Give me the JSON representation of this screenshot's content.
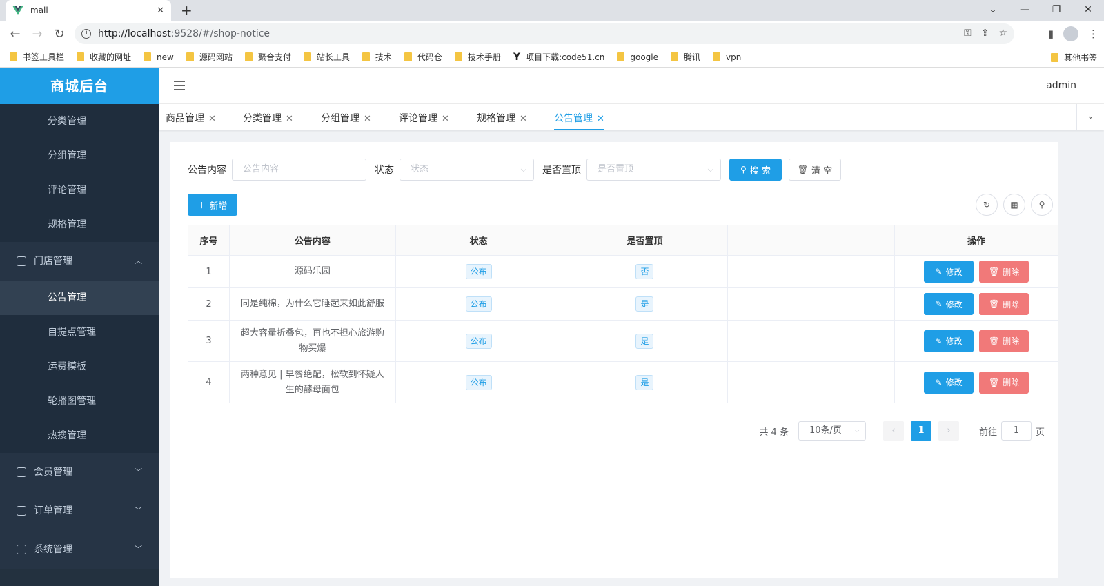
{
  "browser": {
    "tab_title": "mall",
    "url_host": "http://localhost",
    "url_rest": ":9528/#/shop-notice",
    "new_tab": "+",
    "tab_close": "✕"
  },
  "bookmarks": [
    {
      "label": "书签工具栏"
    },
    {
      "label": "收藏的网址"
    },
    {
      "label": "new"
    },
    {
      "label": "源码网站"
    },
    {
      "label": "聚合支付"
    },
    {
      "label": "站长工具"
    },
    {
      "label": "技术"
    },
    {
      "label": "代码仓"
    },
    {
      "label": "技术手册"
    },
    {
      "label": "项目下载:code51.cn"
    },
    {
      "label": "google"
    },
    {
      "label": "腾讯"
    },
    {
      "label": "vpn"
    }
  ],
  "bookmarks_other": "其他书签",
  "app": {
    "brand": "商城后台",
    "user": "admin"
  },
  "sidebar": {
    "items": [
      {
        "label": "分类管理",
        "type": "sub"
      },
      {
        "label": "分组管理",
        "type": "sub"
      },
      {
        "label": "评论管理",
        "type": "sub"
      },
      {
        "label": "规格管理",
        "type": "sub"
      },
      {
        "label": "门店管理",
        "type": "group",
        "icon": "store-icon",
        "expanded": true
      },
      {
        "label": "公告管理",
        "type": "sub",
        "active": true
      },
      {
        "label": "自提点管理",
        "type": "sub"
      },
      {
        "label": "运费模板",
        "type": "sub"
      },
      {
        "label": "轮播图管理",
        "type": "sub"
      },
      {
        "label": "热搜管理",
        "type": "sub"
      },
      {
        "label": "会员管理",
        "type": "group",
        "icon": "member-icon"
      },
      {
        "label": "订单管理",
        "type": "group",
        "icon": "order-icon"
      },
      {
        "label": "系统管理",
        "type": "group",
        "icon": "settings-icon"
      }
    ]
  },
  "tags": [
    {
      "label": "商品管理"
    },
    {
      "label": "分类管理"
    },
    {
      "label": "分组管理"
    },
    {
      "label": "评论管理"
    },
    {
      "label": "规格管理"
    },
    {
      "label": "公告管理",
      "active": true
    }
  ],
  "search": {
    "content_label": "公告内容",
    "content_placeholder": "公告内容",
    "status_label": "状态",
    "status_placeholder": "状态",
    "top_label": "是否置顶",
    "top_placeholder": "是否置顶",
    "search_btn": "搜 索",
    "clear_btn": "清 空"
  },
  "actions": {
    "add_btn": "新增"
  },
  "table": {
    "columns": [
      "序号",
      "公告内容",
      "状态",
      "是否置顶",
      "",
      "操作"
    ],
    "rows": [
      {
        "index": "1",
        "content": "源码乐园",
        "status": "公布",
        "top": "否",
        "edit": "修改",
        "delete": "删除"
      },
      {
        "index": "2",
        "content": "同是纯棉，为什么它睡起来如此舒服",
        "status": "公布",
        "top": "是",
        "edit": "修改",
        "delete": "删除"
      },
      {
        "index": "3",
        "content": "超大容量折叠包，再也不担心旅游购物买爆",
        "status": "公布",
        "top": "是",
        "edit": "修改",
        "delete": "删除"
      },
      {
        "index": "4",
        "content": "两种意见 | 早餐绝配，松软到怀疑人生的酵母面包",
        "status": "公布",
        "top": "是",
        "edit": "修改",
        "delete": "删除"
      }
    ]
  },
  "pagination": {
    "total": "共 4 条",
    "page_size": "10条/页",
    "current": "1",
    "goto_label": "前往",
    "goto_value": "1",
    "goto_suffix": "页"
  },
  "colors": {
    "primary": "#1f9ee6",
    "danger": "#f17979",
    "sidebar_bg": "#1f2d3d"
  }
}
